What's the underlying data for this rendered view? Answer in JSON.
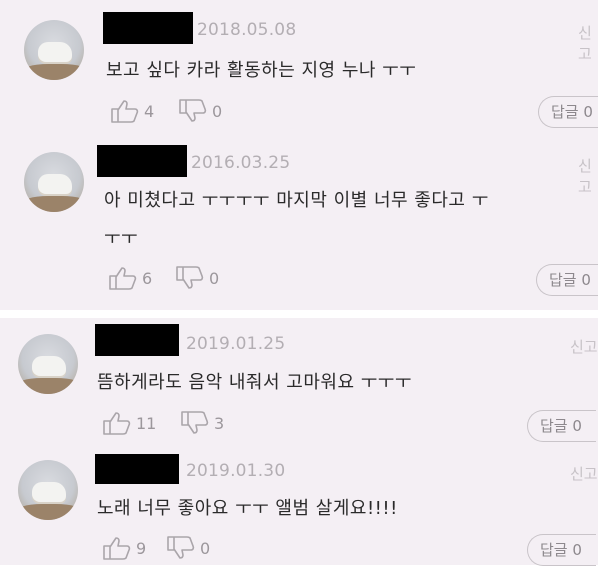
{
  "comments": [
    {
      "date": "2018.05.08",
      "report_label": "신고",
      "text_line1": "보고 싶다 카라 활동하는 지영 누나 ㅜㅜ",
      "text_line2": "",
      "likes": "4",
      "dislikes": "0",
      "reply_label": "답글 0"
    },
    {
      "date": "2016.03.25",
      "report_label": "신고",
      "text_line1": "아 미쳤다고 ㅜㅜㅜㅜ 마지막 이별 너무 좋다고 ㅜ",
      "text_line2": "ㅜㅜ",
      "likes": "6",
      "dislikes": "0",
      "reply_label": "답글 0"
    },
    {
      "date": "2019.01.25",
      "report_label": "신고",
      "text_line1": "뜸하게라도 음악 내줘서 고마워요 ㅜㅜㅜ",
      "text_line2": "",
      "likes": "11",
      "dislikes": "3",
      "reply_label": "답글 0"
    },
    {
      "date": "2019.01.30",
      "report_label": "신고",
      "text_line1": "노래 너무 좋아요 ㅜㅜ 앨범 살게요!!!!",
      "text_line2": "",
      "likes": "9",
      "dislikes": "0",
      "reply_label": "답글 0"
    }
  ],
  "icons": {
    "like": "thumbs-up-icon",
    "dislike": "thumbs-down-icon"
  },
  "colors": {
    "background": "#f4eff4",
    "redaction": "#000000",
    "muted_text": "#b3aeb3"
  }
}
